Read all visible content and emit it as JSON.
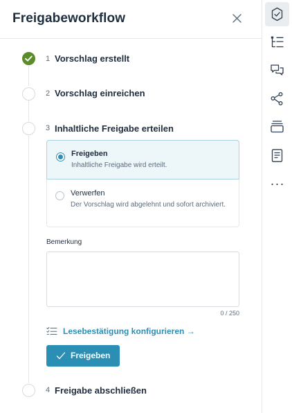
{
  "panel": {
    "title": "Freigabeworkflow"
  },
  "steps": [
    {
      "number": "1",
      "label": "Vorschlag erstellt",
      "status": "done"
    },
    {
      "number": "2",
      "label": "Vorschlag einreichen",
      "status": "open"
    },
    {
      "number": "3",
      "label": "Inhaltliche Freigabe erteilen",
      "status": "active"
    },
    {
      "number": "4",
      "label": "Freigabe abschließen",
      "status": "open"
    }
  ],
  "decision": {
    "options": [
      {
        "title": "Freigeben",
        "description": "Inhaltliche Freigabe wird erteilt.",
        "selected": true
      },
      {
        "title": "Verwerfen",
        "description": "Der Vorschlag wird abgelehnt und sofort archiviert.",
        "selected": false
      }
    ],
    "remark_label": "Bemerkung",
    "remark_value": "",
    "remark_counter": "0 / 250",
    "read_confirmation_link": "Lesebestätigung konfigurieren →",
    "submit_label": "Freigeben"
  },
  "rail": {
    "items": [
      {
        "icon": "approval-check-icon",
        "active": true
      },
      {
        "icon": "tree-structure-icon",
        "active": false
      },
      {
        "icon": "comments-icon",
        "active": false
      },
      {
        "icon": "share-nodes-icon",
        "active": false
      },
      {
        "icon": "layers-icon",
        "active": false
      },
      {
        "icon": "document-icon",
        "active": false
      },
      {
        "icon": "more-icon",
        "active": false
      }
    ]
  },
  "colors": {
    "accent": "#2b8fb5",
    "done": "#5b8c2a",
    "selected_bg": "#edf7fa",
    "border": "#e3e8ec"
  }
}
